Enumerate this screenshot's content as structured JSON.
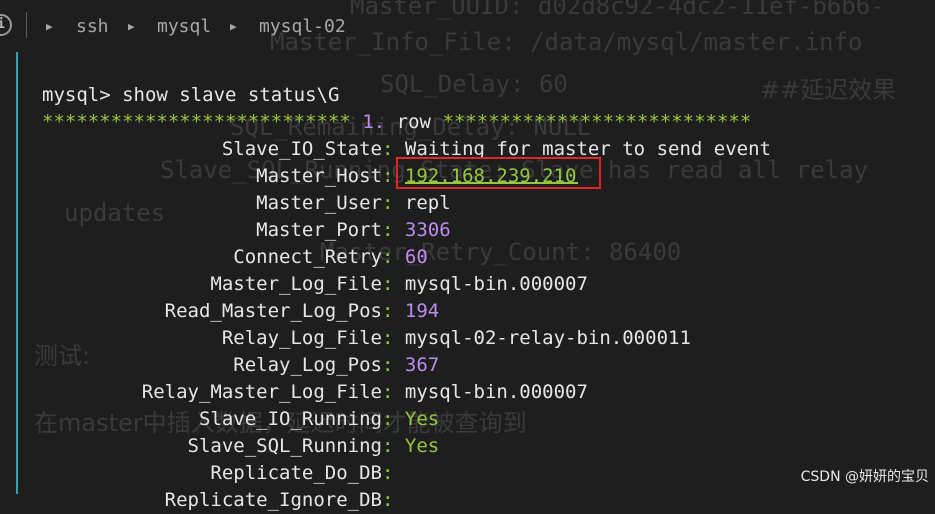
{
  "background_page": {
    "uuid_line": "Master_UUID: d02d8c92-4dc2-11ef-b6b6-",
    "info_file_line": "Master_Info_File: /data/mysql/master.info",
    "sql_delay_line": "SQL_Delay: 60",
    "sql_delay_comment": "##延迟效果",
    "remaining_delay_line": "SQL_Remaining_Delay: NULL",
    "io_state_line": "Slave_SQL_Running_State: Slave has read all relay",
    "updates_word": "updates",
    "retry_count_line": "Master_Retry_Count: 86400",
    "test_heading": "测试:",
    "master_line": "在master中插入数据，延迟时间才能被查询到"
  },
  "breadcrumb": {
    "items": [
      "ssh",
      "mysql",
      "mysql-02"
    ]
  },
  "terminal": {
    "prompt": "mysql>",
    "command": "show slave status\\G",
    "stars_left": "***************************",
    "row_number": "1.",
    "row_word": "row",
    "stars_right": "***************************",
    "fields": [
      {
        "key": "Slave_IO_State",
        "value": "Waiting for master to send event"
      },
      {
        "key": "Master_Host",
        "value": "192.168.239.210"
      },
      {
        "key": "Master_User",
        "value": "repl"
      },
      {
        "key": "Master_Port",
        "value": "3306"
      },
      {
        "key": "Connect_Retry",
        "value": "60"
      },
      {
        "key": "Master_Log_File",
        "value": "mysql-bin.000007"
      },
      {
        "key": "Read_Master_Log_Pos",
        "value": "194"
      },
      {
        "key": "Relay_Log_File",
        "value": "mysql-02-relay-bin.000011"
      },
      {
        "key": "Relay_Log_Pos",
        "value": "367"
      },
      {
        "key": "Relay_Master_Log_File",
        "value": "mysql-bin.000007"
      },
      {
        "key": "Slave_IO_Running",
        "value": "Yes"
      },
      {
        "key": "Slave_SQL_Running",
        "value": "Yes"
      },
      {
        "key": "Replicate_Do_DB",
        "value": ""
      },
      {
        "key": "Replicate_Ignore_DB",
        "value": ""
      }
    ]
  },
  "watermark": "CSDN @妍妍的宝贝",
  "colors": {
    "accent_green": "#95c93d",
    "number_purple": "#bc8cf0",
    "highlight_red": "#e02727",
    "gutter_cyan": "#2ea3b8"
  }
}
